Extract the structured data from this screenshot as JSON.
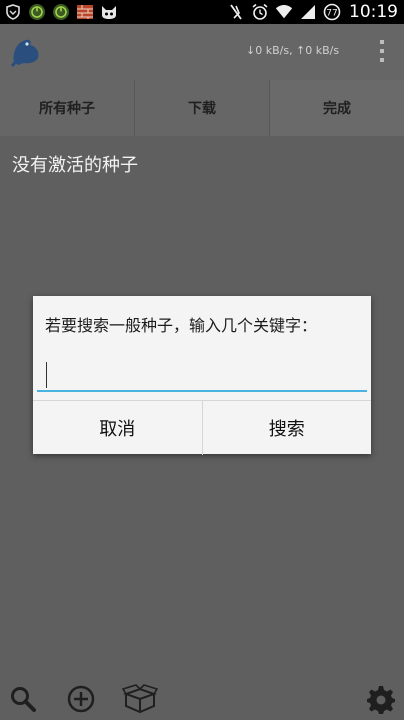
{
  "statusbar": {
    "time": "10:19",
    "left_icons": [
      "shield-icon",
      "android-debug-icon",
      "android-debug-icon",
      "brick-app-icon",
      "cat-face-icon"
    ],
    "right_icons": [
      "notification-off-icon",
      "alarm-icon",
      "wifi-icon",
      "signal-icon",
      "battery-icon"
    ]
  },
  "actionbar": {
    "speed": "↓0 kB/s, ↑0 kB/s",
    "logo_icon": "frog-logo-icon",
    "overflow_icon": "overflow-menu-icon"
  },
  "tabs": [
    {
      "label": "所有种子",
      "active": false
    },
    {
      "label": "下载",
      "active": false
    },
    {
      "label": "完成",
      "active": true
    }
  ],
  "main": {
    "empty_message": "没有激活的种子"
  },
  "dialog": {
    "prompt": "若要搜索一般种子，输入几个关键字：",
    "input_value": "",
    "cancel_label": "取消",
    "search_label": "搜索"
  },
  "bottombar": {
    "icons": [
      "search-icon",
      "add-icon",
      "box-icon",
      "settings-icon"
    ]
  },
  "colors": {
    "background": "#5f5f5f",
    "input_underline": "#4ab3df",
    "dialog_bg": "#f4f4f4"
  }
}
